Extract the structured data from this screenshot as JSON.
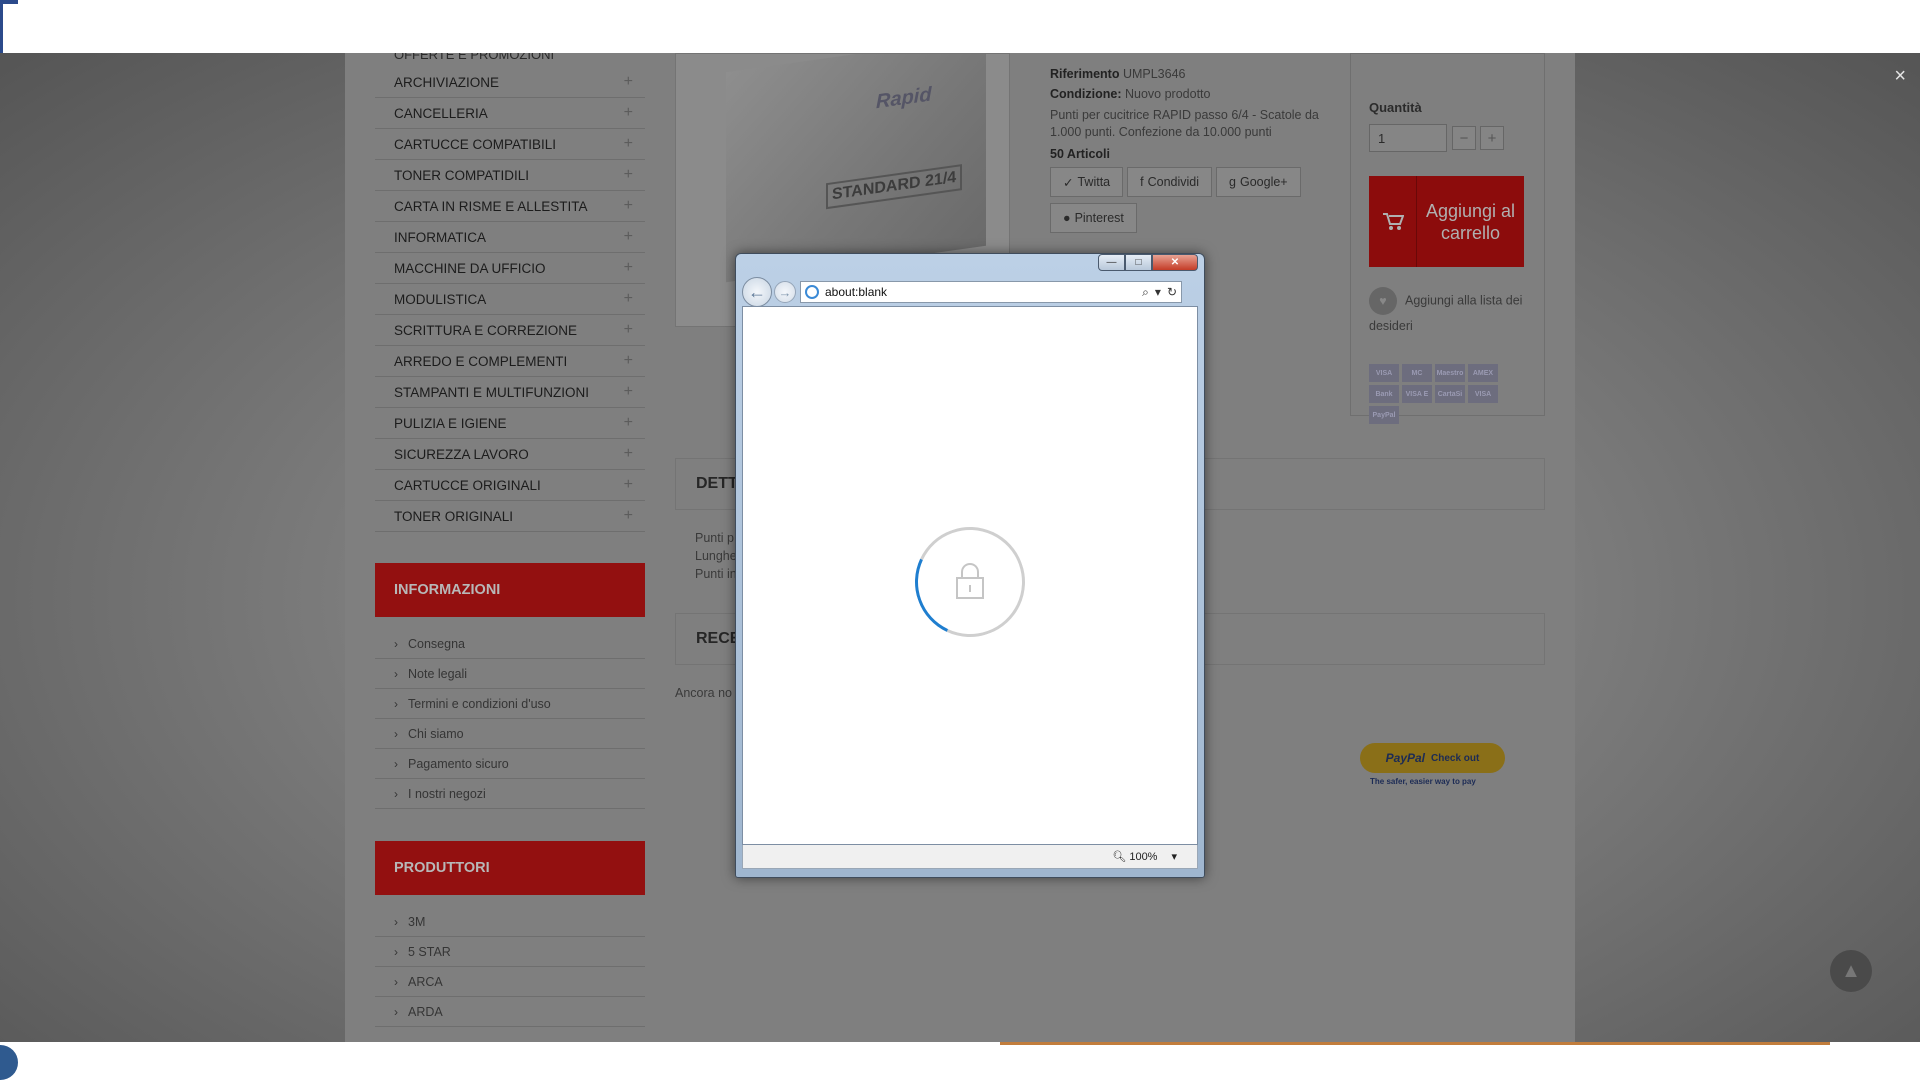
{
  "menu": {
    "partial_top": "OFFERTE E PROMOZIONI",
    "items": [
      {
        "label": "ARCHIVIAZIONE"
      },
      {
        "label": "CANCELLERIA"
      },
      {
        "label": "CARTUCCE COMPATIBILI"
      },
      {
        "label": "TONER COMPATIDILI"
      },
      {
        "label": "CARTA IN RISME E ALLESTITA"
      },
      {
        "label": "INFORMATICA"
      },
      {
        "label": "MACCHINE DA UFFICIO"
      },
      {
        "label": "MODULISTICA"
      },
      {
        "label": "SCRITTURA E CORREZIONE"
      },
      {
        "label": "ARREDO E COMPLEMENTI"
      },
      {
        "label": "STAMPANTI E MULTIFUNZIONI"
      },
      {
        "label": "PULIZIA E IGIENE"
      },
      {
        "label": "SICUREZZA LAVORO"
      },
      {
        "label": "CARTUCCE ORIGINALI"
      },
      {
        "label": "TONER ORIGINALI"
      }
    ],
    "plus_glyph": "+"
  },
  "informazioni": {
    "title": "INFORMAZIONI",
    "links": [
      "Consegna",
      "Note legali",
      "Termini e condizioni d'uso",
      "Chi siamo",
      "Pagamento sicuro",
      "I nostri negozi"
    ]
  },
  "produttori": {
    "title": "PRODUTTORI",
    "links": [
      "3M",
      "5 STAR",
      "ARCA",
      "ARDA"
    ]
  },
  "product": {
    "image_brand": "Rapid",
    "image_label": "STANDARD 21/4",
    "riferimento_label": "Riferimento",
    "riferimento_value": "UMPL3646",
    "condizione_label": "Condizione:",
    "condizione_value": "Nuovo prodotto",
    "description": "Punti per cucitrice RAPID passo 6/4 - Scatole da 1.000 punti. Confezione da 10.000 punti",
    "stock": "50 Articoli",
    "social": {
      "twitta": "Twitta",
      "condividi": "Condividi",
      "google": "Google+",
      "pinterest": "Pinterest"
    }
  },
  "cart": {
    "quantity_label": "Quantità",
    "quantity_value": "1",
    "minus": "−",
    "plus": "+",
    "add_label": "Aggiungi al carrello",
    "wishlist_label": "Aggiungi alla lista dei desideri",
    "cards": [
      "VISA",
      "MC",
      "Maestro",
      "AMEX",
      "Bank",
      "VISA E",
      "CartaSi",
      "VISA",
      "PayPal"
    ]
  },
  "sections": {
    "details_title": "DETT",
    "details_lines": [
      "Punti p",
      "Lunghe",
      "Punti in"
    ],
    "reviews_title": "RECE",
    "reviews_text": "Ancora no"
  },
  "paypal": {
    "label": "PayPal",
    "action": "Check out",
    "tagline": "The safer, easier way to pay"
  },
  "overlay": {
    "close_glyph": "×"
  },
  "popup": {
    "url": "about:blank",
    "zoom": "100%",
    "min": "—",
    "max": "□",
    "close": "✕"
  },
  "colors": {
    "accent_red": "#931010",
    "spinner_blue": "#1f7ecf"
  }
}
